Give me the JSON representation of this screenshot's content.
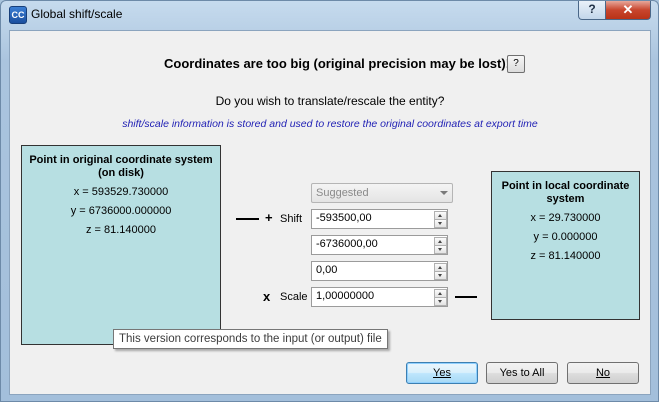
{
  "window": {
    "title": "Global shift/scale",
    "app_icon_text": "CC",
    "help_button": "?",
    "close_button": "✕"
  },
  "dialog": {
    "heading": "Coordinates are too big (original precision may be lost)!",
    "heading_help": "?",
    "question": "Do you wish to translate/rescale the entity?",
    "info": "shift/scale information is stored and used to restore the original coordinates at export time"
  },
  "original": {
    "title": "Point in original coordinate system (on disk)",
    "x": "x = 593529.730000",
    "y": "y = 6736000.000000",
    "z": "z = 81.140000"
  },
  "local": {
    "title": "Point in local coordinate system",
    "x": "x = 29.730000",
    "y": "y = 0.000000",
    "z": "z = 81.140000"
  },
  "transform": {
    "preset": "Suggested",
    "plus_symbol": "+",
    "shift_label": "Shift",
    "shift_x": "-593500,00",
    "shift_y": "-6736000,00",
    "shift_z": "0,00",
    "times_symbol": "x",
    "scale_label": "Scale",
    "scale": "1,00000000"
  },
  "tooltip": "This version corresponds to the input (or output) file",
  "buttons": {
    "yes": "Yes",
    "yes_to_all": "Yes to All",
    "no": "No"
  }
}
